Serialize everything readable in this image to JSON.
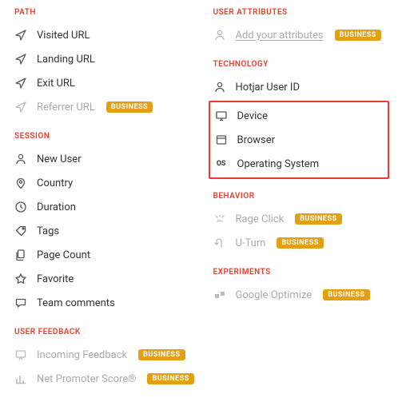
{
  "badge_label": "BUSINESS",
  "left": {
    "sections": [
      {
        "header": "PATH",
        "items": [
          {
            "id": "visited-url",
            "label": "Visited URL",
            "icon": "cursor",
            "disabled": false,
            "badge": false
          },
          {
            "id": "landing-url",
            "label": "Landing URL",
            "icon": "cursor",
            "disabled": false,
            "badge": false
          },
          {
            "id": "exit-url",
            "label": "Exit URL",
            "icon": "cursor",
            "disabled": false,
            "badge": false
          },
          {
            "id": "referrer-url",
            "label": "Referrer URL",
            "icon": "cursor",
            "disabled": true,
            "badge": true
          }
        ]
      },
      {
        "header": "SESSION",
        "items": [
          {
            "id": "new-user",
            "label": "New User",
            "icon": "user",
            "disabled": false,
            "badge": false
          },
          {
            "id": "country",
            "label": "Country",
            "icon": "pin",
            "disabled": false,
            "badge": false
          },
          {
            "id": "duration",
            "label": "Duration",
            "icon": "clock",
            "disabled": false,
            "badge": false
          },
          {
            "id": "tags",
            "label": "Tags",
            "icon": "tag",
            "disabled": false,
            "badge": false
          },
          {
            "id": "page-count",
            "label": "Page Count",
            "icon": "pages",
            "disabled": false,
            "badge": false
          },
          {
            "id": "favorite",
            "label": "Favorite",
            "icon": "star",
            "disabled": false,
            "badge": false
          },
          {
            "id": "team-comments",
            "label": "Team comments",
            "icon": "comment",
            "disabled": false,
            "badge": false
          }
        ]
      },
      {
        "header": "USER FEEDBACK",
        "items": [
          {
            "id": "incoming-feedback",
            "label": "Incoming Feedback",
            "icon": "feedback",
            "disabled": true,
            "badge": true
          },
          {
            "id": "nps",
            "label": "Net Promoter Score®",
            "icon": "bars",
            "disabled": true,
            "badge": true
          }
        ]
      }
    ]
  },
  "right": {
    "sections": [
      {
        "header": "USER ATTRIBUTES",
        "items": [
          {
            "id": "add-attributes",
            "label": "Add your attributes",
            "icon": "user",
            "disabled": true,
            "badge": true,
            "underline": true
          }
        ]
      },
      {
        "header": "TECHNOLOGY",
        "items": [
          {
            "id": "hotjar-user-id",
            "label": "Hotjar User ID",
            "icon": "user",
            "disabled": false,
            "badge": false
          }
        ],
        "highlighted_items": [
          {
            "id": "device",
            "label": "Device",
            "icon": "monitor",
            "disabled": false,
            "badge": false
          },
          {
            "id": "browser",
            "label": "Browser",
            "icon": "window",
            "disabled": false,
            "badge": false
          },
          {
            "id": "operating-system",
            "label": "Operating System",
            "icon": "os",
            "disabled": false,
            "badge": false
          }
        ]
      },
      {
        "header": "BEHAVIOR",
        "items": [
          {
            "id": "rage-click",
            "label": "Rage Click",
            "icon": "rage",
            "disabled": true,
            "badge": true
          },
          {
            "id": "u-turn",
            "label": "U-Turn",
            "icon": "uturn",
            "disabled": true,
            "badge": true
          }
        ]
      },
      {
        "header": "EXPERIMENTS",
        "items": [
          {
            "id": "google-optimize",
            "label": "Google Optimize",
            "icon": "optimize",
            "disabled": true,
            "badge": true
          }
        ]
      }
    ]
  }
}
